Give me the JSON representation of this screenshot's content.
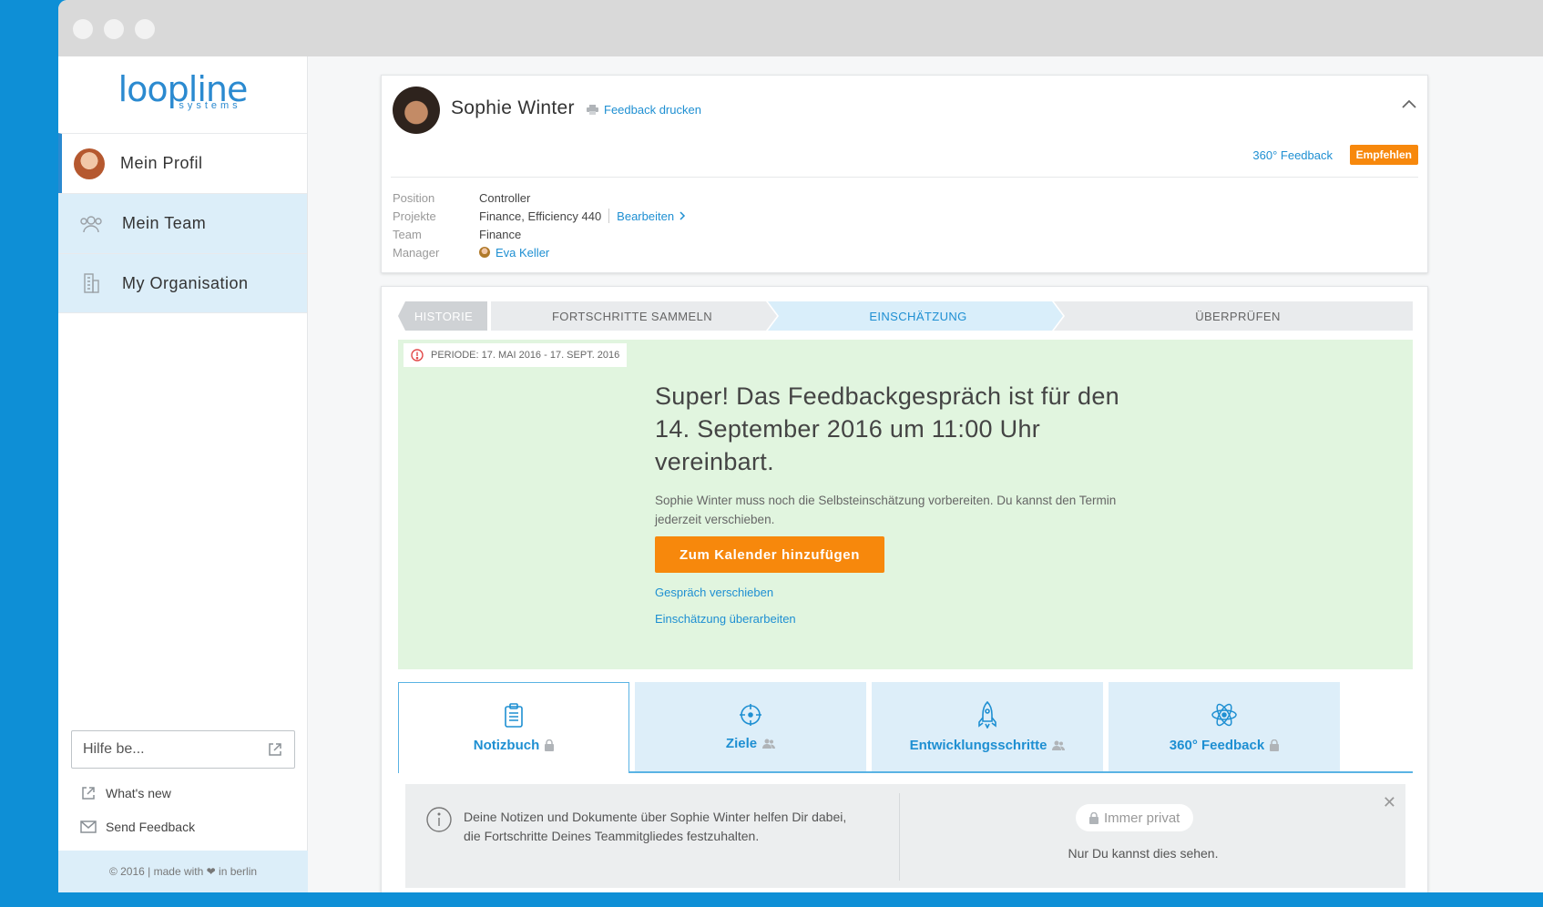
{
  "app": {
    "logo_main": "loopline",
    "logo_sub": "systems"
  },
  "sidebar": {
    "items": [
      {
        "label": "Mein Profil"
      },
      {
        "label": "Mein Team"
      },
      {
        "label": "My Organisation"
      }
    ],
    "help_placeholder": "Hilfe be...",
    "whats_new": "What's new",
    "send_feedback": "Send Feedback",
    "footer": "© 2016 | made with ❤ in berlin"
  },
  "profile": {
    "name": "Sophie Winter",
    "print_label": "Feedback drucken",
    "feedback_360": "360° Feedback",
    "recommend_badge": "Empfehlen",
    "position_label": "Position",
    "position_value": "Controller",
    "projects_label": "Projekte",
    "projects_value": "Finance, Efficiency 440",
    "edit_label": "Bearbeiten",
    "team_label": "Team",
    "team_value": "Finance",
    "manager_label": "Manager",
    "manager_value": "Eva Keller"
  },
  "steps": [
    {
      "label": "HISTORIE"
    },
    {
      "label": "FORTSCHRITTE SAMMELN"
    },
    {
      "label": "EINSCHÄTZUNG"
    },
    {
      "label": "ÜBERPRÜFEN"
    }
  ],
  "status": {
    "period": "PERIODE: 17. MAI 2016 - 17. SEPT. 2016",
    "headline": "Super! Das Feedbackgespräch ist für den 14. September 2016 um 11:00 Uhr vereinbart.",
    "description": "Sophie Winter muss noch die Selbsteinschätzung vorbereiten. Du kannst den Termin jederzeit verschieben.",
    "calendar_button": "Zum Kalender hinzufügen",
    "reschedule_link": "Gespräch verschieben",
    "revise_link": "Einschätzung überarbeiten"
  },
  "tabs": [
    {
      "label": "Notizbuch",
      "icon": "clipboard-icon"
    },
    {
      "label": "Ziele",
      "icon": "target-icon"
    },
    {
      "label": "Entwicklungsschritte",
      "icon": "rocket-icon"
    },
    {
      "label": "360° Feedback",
      "icon": "atom-icon"
    }
  ],
  "notice": {
    "text": "Deine Notizen und Dokumente über Sophie Winter helfen Dir dabei, die Fortschritte Deines Teammitgliedes festzuhalten.",
    "privacy_pill": "Immer privat",
    "privacy_sub": "Nur Du kannst dies sehen."
  },
  "colors": {
    "accent": "#1e8fd2",
    "orange": "#f7880c",
    "success_bg": "#e1f5df",
    "nav_inactive_bg": "#dceef9",
    "background": "#0e8fd6"
  }
}
